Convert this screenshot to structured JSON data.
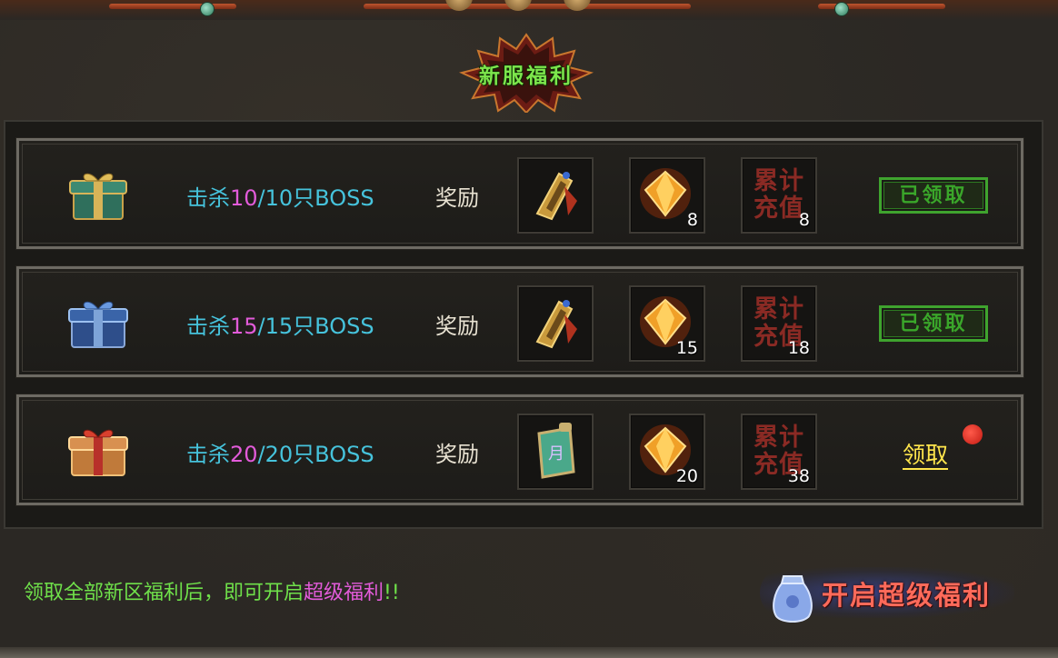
{
  "title": "新服福利",
  "reward_label": "奖励",
  "recharge_label_line1": "累计",
  "recharge_label_line2": "充值",
  "rows": [
    {
      "kill_prefix": "击杀",
      "kill_current": "10",
      "kill_suffix": "/10只BOSS",
      "gem_count": "8",
      "recharge_count": "8",
      "status": "已领取",
      "item1_icon": "gold-shield-icon",
      "chest_icon": "green-gift-chest-icon"
    },
    {
      "kill_prefix": "击杀",
      "kill_current": "15",
      "kill_suffix": "/15只BOSS",
      "gem_count": "15",
      "recharge_count": "18",
      "status": "已领取",
      "item1_icon": "gold-shield-icon",
      "chest_icon": "blue-gift-chest-icon"
    },
    {
      "kill_prefix": "击杀",
      "kill_current": "20",
      "kill_suffix": "/20只BOSS",
      "gem_count": "20",
      "recharge_count": "38",
      "status": "领取",
      "item1_icon": "moon-scroll-icon",
      "chest_icon": "gold-gift-chest-icon"
    }
  ],
  "scroll_char": "月",
  "footer": {
    "note_prefix": "领取全部新区福利后，即可开启",
    "note_highlight": "超级福利",
    "note_suffix": "!!"
  },
  "super_button_label": "开启超级福利",
  "colors": {
    "kill_text": "#46c3dc",
    "kill_current": "#e25bd9",
    "claimed": "#3aa62a",
    "claim": "#ffe64c",
    "title": "#7de64c"
  }
}
